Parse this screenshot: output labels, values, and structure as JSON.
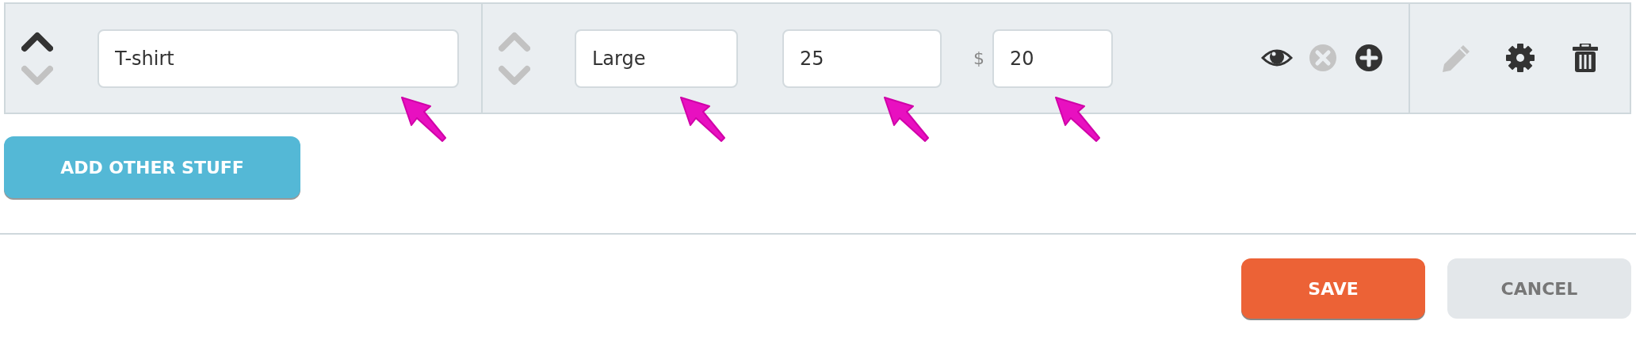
{
  "item_row": {
    "name_cell": {
      "move_up": {
        "disabled": false
      },
      "move_down": {
        "disabled": true
      },
      "field": {
        "value": "T-shirt",
        "pointed": true
      }
    },
    "variant_cell": {
      "move_up": {
        "disabled": true
      },
      "move_down": {
        "disabled": true
      },
      "fields": [
        {
          "value": "Large",
          "pointed": true
        },
        {
          "value": "25",
          "pointed": true
        },
        {
          "prefix": "$",
          "value": "20",
          "pointed": true
        }
      ],
      "actions": [
        {
          "kind": "view",
          "disabled": false
        },
        {
          "kind": "remove",
          "disabled": true
        },
        {
          "kind": "add",
          "disabled": false
        }
      ]
    },
    "row_actions": [
      {
        "kind": "edit",
        "disabled": true
      },
      {
        "kind": "settings",
        "disabled": false
      },
      {
        "kind": "delete",
        "disabled": false
      }
    ]
  },
  "add_button": {
    "label": "ADD OTHER STUFF"
  },
  "footer": {
    "buttons": [
      {
        "label": "SAVE",
        "kind": "primary"
      },
      {
        "label": "CANCEL",
        "kind": "secondary"
      }
    ]
  }
}
